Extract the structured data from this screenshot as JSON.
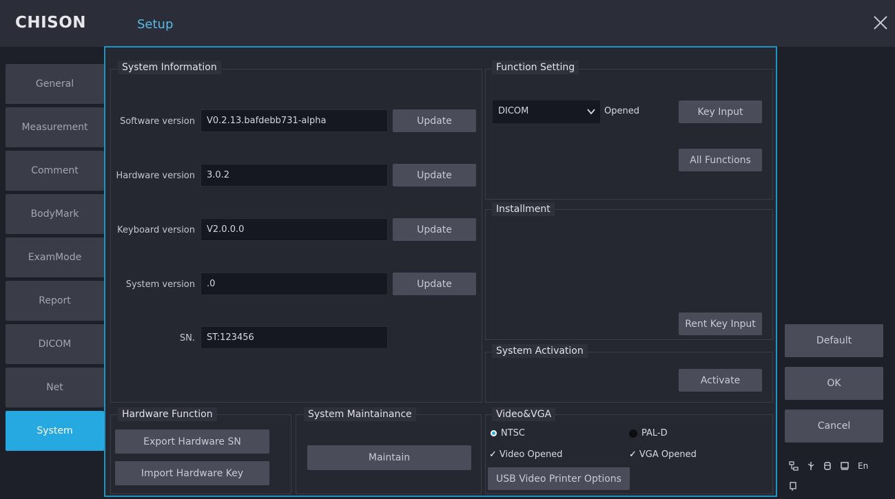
{
  "header": {
    "logo": "CHISON",
    "title": "Setup",
    "close_icon": "close-icon"
  },
  "sidebar": {
    "items": [
      {
        "label": "General"
      },
      {
        "label": "Measurement"
      },
      {
        "label": "Comment"
      },
      {
        "label": "BodyMark"
      },
      {
        "label": "ExamMode"
      },
      {
        "label": "Report"
      },
      {
        "label": "DICOM"
      },
      {
        "label": "Net"
      },
      {
        "label": "System",
        "active": true
      }
    ]
  },
  "system_info": {
    "title": "System Information",
    "software": {
      "label": "Software version",
      "value": "V0.2.13.bafdebb731-alpha",
      "button": "Update"
    },
    "hardware": {
      "label": "Hardware version",
      "value": "3.0.2",
      "button": "Update"
    },
    "keyboard": {
      "label": "Keyboard version",
      "value": "V2.0.0.0",
      "button": "Update"
    },
    "system": {
      "label": "System version",
      "value": ".0",
      "button": "Update"
    },
    "sn": {
      "label": "SN.",
      "value": "ST:123456"
    }
  },
  "function_setting": {
    "title": "Function Setting",
    "dropdown_value": "DICOM",
    "status": "Opened",
    "key_input": "Key Input",
    "all_functions": "All Functions"
  },
  "installment": {
    "title": "Installment",
    "rent_key_input": "Rent Key Input"
  },
  "system_activation": {
    "title": "System Activation",
    "activate": "Activate"
  },
  "hardware_function": {
    "title": "Hardware Function",
    "export": "Export Hardware SN",
    "import": "Import Hardware Key"
  },
  "system_maintainance": {
    "title": "System Maintainance",
    "maintain": "Maintain"
  },
  "video_vga": {
    "title": "Video&VGA",
    "ntsc": "NTSC",
    "pal": "PAL-D",
    "video_opened": "Video Opened",
    "vga_opened": "VGA Opened",
    "usb_printer": "USB Video Printer Options"
  },
  "actions": {
    "default": "Default",
    "ok": "OK",
    "cancel": "Cancel"
  },
  "status_bar": {
    "lang": "En"
  },
  "colors": {
    "accent": "#26a8e0",
    "title_text": "#5ab9e6"
  }
}
